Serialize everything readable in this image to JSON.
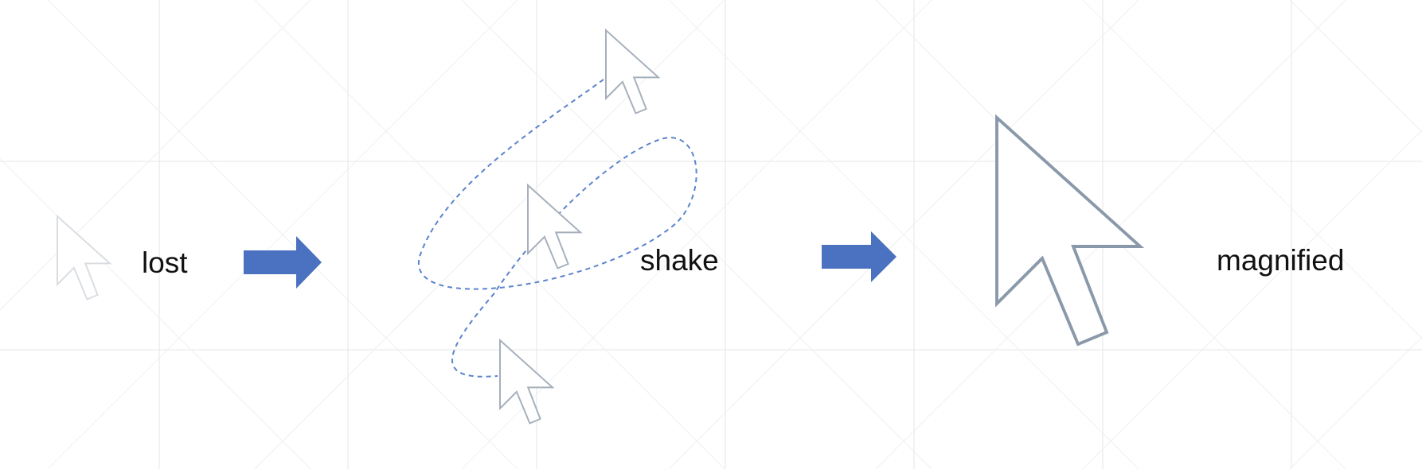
{
  "labels": {
    "lost": "lost",
    "shake": "shake",
    "magnified": "magnified"
  },
  "icons": {
    "cursor": "mouse-pointer-icon",
    "arrow": "right-arrow-icon"
  },
  "colors": {
    "arrow": "#4a72c0",
    "shake_path": "#5b84cc",
    "cursor_outline": "#8a99aa",
    "cursor_faint": "#d9dde2",
    "grid": "#e4e4e4"
  }
}
